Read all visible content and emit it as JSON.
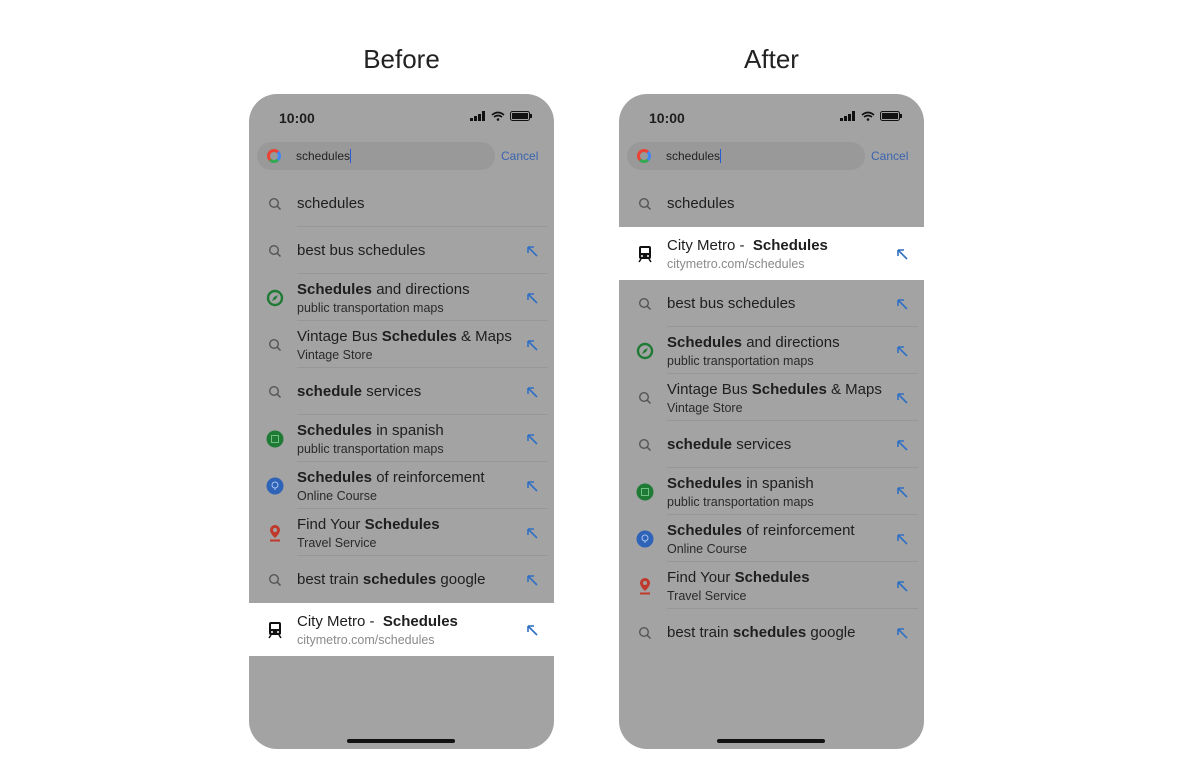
{
  "colors": {
    "phone_bg": "#a3a3a3",
    "highlight_bg": "#ffffff",
    "accent": "#3a64b0"
  },
  "phones": [
    {
      "heading": "Before",
      "time": "10:00",
      "query": "schedules",
      "cancel": "Cancel",
      "items": [
        {
          "icon": "search-icon",
          "title": [
            {
              "t": "schedules",
              "b": false
            }
          ],
          "arrow": false
        },
        {
          "icon": "search-icon",
          "title": [
            {
              "t": "best bus schedules",
              "b": false
            }
          ],
          "arrow": true
        },
        {
          "icon": "compass-icon",
          "title": [
            {
              "t": "Schedules",
              "b": true
            },
            {
              "t": " and directions",
              "b": false
            }
          ],
          "sub": "public transportation maps",
          "arrow": true
        },
        {
          "icon": "search-icon",
          "title": [
            {
              "t": "Vintage Bus ",
              "b": false
            },
            {
              "t": "Schedules",
              "b": true
            },
            {
              "t": " & Maps",
              "b": false
            }
          ],
          "sub": "Vintage Store",
          "arrow": true
        },
        {
          "icon": "search-icon",
          "title": [
            {
              "t": "schedule",
              "b": true
            },
            {
              "t": " services",
              "b": false
            }
          ],
          "arrow": true
        },
        {
          "icon": "calendar-icon",
          "title": [
            {
              "t": "Schedules",
              "b": true
            },
            {
              "t": " in spanish",
              "b": false
            }
          ],
          "sub": "public transportation maps",
          "arrow": true
        },
        {
          "icon": "lightbulb-icon",
          "title": [
            {
              "t": "Schedules",
              "b": true
            },
            {
              "t": " of reinforcement",
              "b": false
            }
          ],
          "sub": "Online Course",
          "arrow": true
        },
        {
          "icon": "map-pin-icon",
          "title": [
            {
              "t": "Find Your ",
              "b": false
            },
            {
              "t": "Schedules",
              "b": true
            }
          ],
          "sub": "Travel Service",
          "arrow": true
        },
        {
          "icon": "search-icon",
          "title": [
            {
              "t": "best train ",
              "b": false
            },
            {
              "t": "schedules",
              "b": true
            },
            {
              "t": " google",
              "b": false
            }
          ],
          "arrow": true
        },
        {
          "icon": "train-icon",
          "title": [
            {
              "t": "City Metro -  ",
              "b": false
            },
            {
              "t": "Schedules",
              "b": true
            }
          ],
          "sub": "citymetro.com/schedules",
          "arrow": true,
          "highlight": true
        }
      ]
    },
    {
      "heading": "After",
      "time": "10:00",
      "query": "schedules",
      "cancel": "Cancel",
      "items": [
        {
          "icon": "search-icon",
          "title": [
            {
              "t": "schedules",
              "b": false
            }
          ],
          "arrow": false
        },
        {
          "icon": "train-icon",
          "title": [
            {
              "t": "City Metro -  ",
              "b": false
            },
            {
              "t": "Schedules",
              "b": true
            }
          ],
          "sub": "citymetro.com/schedules",
          "arrow": true,
          "highlight": true
        },
        {
          "icon": "search-icon",
          "title": [
            {
              "t": "best bus schedules",
              "b": false
            }
          ],
          "arrow": true
        },
        {
          "icon": "compass-icon",
          "title": [
            {
              "t": "Schedules",
              "b": true
            },
            {
              "t": " and directions",
              "b": false
            }
          ],
          "sub": "public transportation maps",
          "arrow": true
        },
        {
          "icon": "search-icon",
          "title": [
            {
              "t": "Vintage Bus ",
              "b": false
            },
            {
              "t": "Schedules",
              "b": true
            },
            {
              "t": " & Maps",
              "b": false
            }
          ],
          "sub": "Vintage Store",
          "arrow": true
        },
        {
          "icon": "search-icon",
          "title": [
            {
              "t": "schedule",
              "b": true
            },
            {
              "t": " services",
              "b": false
            }
          ],
          "arrow": true
        },
        {
          "icon": "calendar-icon",
          "title": [
            {
              "t": "Schedules",
              "b": true
            },
            {
              "t": " in spanish",
              "b": false
            }
          ],
          "sub": "public transportation maps",
          "arrow": true
        },
        {
          "icon": "lightbulb-icon",
          "title": [
            {
              "t": "Schedules",
              "b": true
            },
            {
              "t": " of reinforcement",
              "b": false
            }
          ],
          "sub": "Online Course",
          "arrow": true
        },
        {
          "icon": "map-pin-icon",
          "title": [
            {
              "t": "Find Your ",
              "b": false
            },
            {
              "t": "Schedules",
              "b": true
            }
          ],
          "sub": "Travel Service",
          "arrow": true
        },
        {
          "icon": "search-icon",
          "title": [
            {
              "t": "best train ",
              "b": false
            },
            {
              "t": "schedules",
              "b": true
            },
            {
              "t": " google",
              "b": false
            }
          ],
          "arrow": true
        }
      ]
    }
  ]
}
